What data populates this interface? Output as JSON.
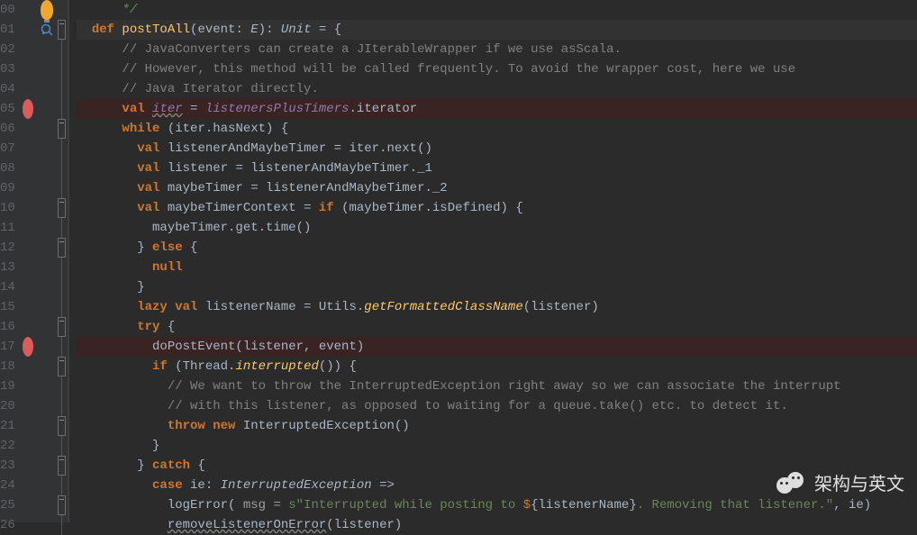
{
  "watermark": "架构与英文",
  "lines": {
    "l00": {
      "num": "00",
      "html": "<span class='green'>*/</span>"
    },
    "l01": {
      "num": "01",
      "html": "<span class='kw-b'>def </span><span class='fn'>postToAll</span>(event: <span class='tp'>E</span>): <span class='tp'>Unit</span> = {"
    },
    "l02": {
      "num": "02",
      "html": "  <span class='cm'>// JavaConverters can create a JIterableWrapper if we use asScala.</span>"
    },
    "l03": {
      "num": "03",
      "html": "  <span class='cm'>// However, this method will be called frequently. To avoid the wrapper cost, here we use</span>"
    },
    "l04": {
      "num": "04",
      "html": "  <span class='cm'>// Java Iterator directly.</span>"
    },
    "l05": {
      "num": "05",
      "html": "  <span class='kw-b'>val</span> <span class='varu'>iter</span> = <span class='var'>listenersPlusTimers</span>.iterator"
    },
    "l06": {
      "num": "06",
      "html": "  <span class='kw-b'>while</span> (iter.hasNext) {"
    },
    "l07": {
      "num": "07",
      "html": "    <span class='kw-b'>val</span> listenerAndMaybeTimer = iter.next()"
    },
    "l08": {
      "num": "08",
      "html": "    <span class='kw-b'>val</span> listener = listenerAndMaybeTimer._1"
    },
    "l09": {
      "num": "09",
      "html": "    <span class='kw-b'>val</span> maybeTimer = listenerAndMaybeTimer._2"
    },
    "l10": {
      "num": "10",
      "html": "    <span class='kw-b'>val</span> maybeTimerContext = <span class='kw-b'>if</span> (maybeTimer.isDefined) {"
    },
    "l11": {
      "num": "11",
      "html": "      maybeTimer.get.time()"
    },
    "l12": {
      "num": "12",
      "html": "    } <span class='kw-b'>else</span> {"
    },
    "l13": {
      "num": "13",
      "html": "      <span class='kw-b'>null</span>"
    },
    "l14": {
      "num": "14",
      "html": "    }"
    },
    "l15": {
      "num": "15",
      "html": "    <span class='kw-b'>lazy</span> <span class='kw-b'>val</span> listenerName = Utils.<span class='fnit'>getFormattedClassName</span>(listener)"
    },
    "l16": {
      "num": "16",
      "html": "    <span class='kw-b'>try</span> {"
    },
    "l17": {
      "num": "17",
      "html": "      doPostEvent(listener<span class='op'>,</span> event)"
    },
    "l18": {
      "num": "18",
      "html": "      <span class='kw-b'>if</span> (Thread.<span class='fnit'>interrupted</span>()) {"
    },
    "l19": {
      "num": "19",
      "html": "        <span class='cm'>// We want to throw the InterruptedException right away so we can associate the interrupt</span>"
    },
    "l20": {
      "num": "20",
      "html": "        <span class='cm'>// with this listener, as opposed to waiting for a queue.take() etc. to detect it.</span>"
    },
    "l21": {
      "num": "21",
      "html": "        <span class='kw-b'>throw new</span> InterruptedException()"
    },
    "l22": {
      "num": "22",
      "html": "      }"
    },
    "l23": {
      "num": "23",
      "html": "    } <span class='kw-b'>catch</span> {"
    },
    "l24": {
      "num": "24",
      "html": "      <span class='kw-b'>case</span> ie: <span class='tp'>InterruptedException</span> =>"
    },
    "l25": {
      "num": "25",
      "html": "        logError(<span class='param'> msg = </span><span class='str'>s\"Interrupted while posting to </span><span class='interp'>$</span>{<span class='interpv'>listenerName</span>}<span class='str'>. Removing that listener.\"</span><span class='op'>,</span> ie)"
    },
    "l26": {
      "num": "26",
      "html": "        <span class='locw'>removeListenerOnError</span>(listener)"
    }
  },
  "gutter": {
    "00": {
      "bulb": true
    },
    "01": {
      "ql": true,
      "fold": "box"
    },
    "02": {
      "fold": "line"
    },
    "03": {
      "fold": "line"
    },
    "04": {
      "fold": "line"
    },
    "05": {
      "bp": true,
      "fold": "line"
    },
    "06": {
      "fold": "box"
    },
    "07": {
      "fold": "line"
    },
    "08": {
      "fold": "line"
    },
    "09": {
      "fold": "line"
    },
    "10": {
      "fold": "box"
    },
    "11": {
      "fold": "line"
    },
    "12": {
      "fold": "box"
    },
    "13": {
      "fold": "line"
    },
    "14": {
      "fold": "line"
    },
    "15": {
      "fold": "line"
    },
    "16": {
      "fold": "box"
    },
    "17": {
      "bp": true,
      "fold": "line"
    },
    "18": {
      "fold": "box"
    },
    "19": {
      "fold": "line"
    },
    "20": {
      "fold": "line"
    },
    "21": {
      "fold": "box"
    },
    "22": {
      "fold": "line"
    },
    "23": {
      "fold": "box"
    },
    "24": {
      "fold": "line"
    },
    "25": {
      "fold": "box"
    },
    "26": {
      "fold": "line"
    }
  }
}
